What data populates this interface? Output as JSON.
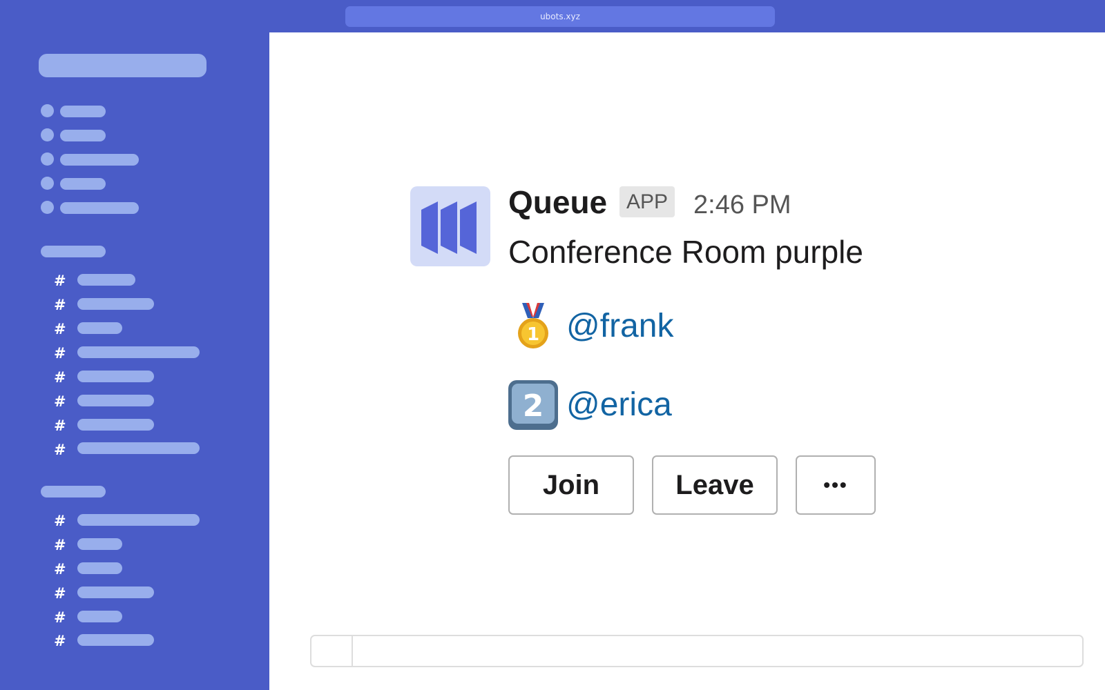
{
  "browser": {
    "url": "ubots.xyz"
  },
  "message": {
    "app_name": "Queue",
    "app_badge": "APP",
    "time": "2:46 PM",
    "text": "Conference Room purple",
    "queue": [
      {
        "position_emoji": "first-place-medal-icon",
        "mention": "@frank"
      },
      {
        "position_emoji": "keycap-2-icon",
        "mention": "@erica"
      }
    ],
    "actions": {
      "join": "Join",
      "leave": "Leave",
      "more": "•••"
    }
  },
  "colors": {
    "sidebar": "#4a5cc7",
    "placeholder": "#98aeec",
    "mention": "#1264a3",
    "avatar_bg": "#d3dbf7",
    "avatar_icon": "#5565d8"
  }
}
